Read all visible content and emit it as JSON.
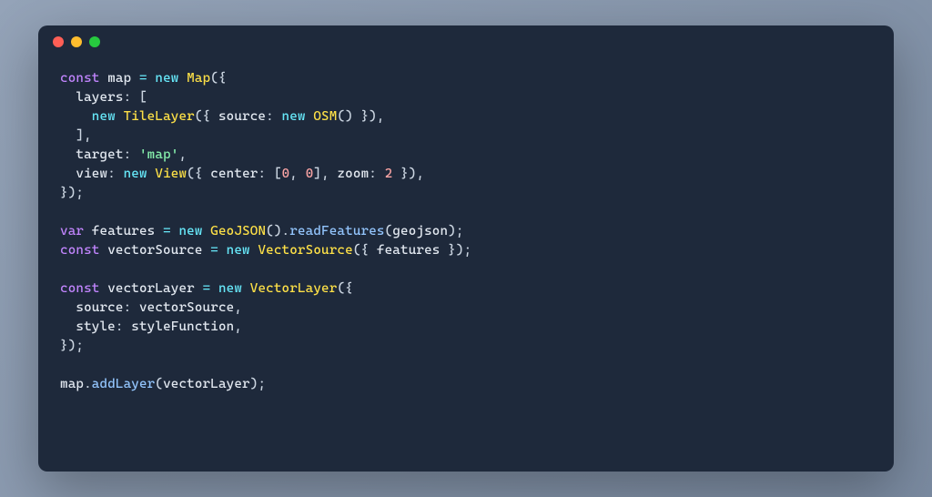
{
  "window": {
    "traffic_lights": [
      "close",
      "minimize",
      "maximize"
    ]
  },
  "code": {
    "tokens": [
      [
        {
          "t": "const",
          "c": "kw"
        },
        {
          "t": " ",
          "c": ""
        },
        {
          "t": "map",
          "c": "var"
        },
        {
          "t": " ",
          "c": ""
        },
        {
          "t": "=",
          "c": "op"
        },
        {
          "t": " ",
          "c": ""
        },
        {
          "t": "new",
          "c": "new"
        },
        {
          "t": " ",
          "c": ""
        },
        {
          "t": "Map",
          "c": "cls"
        },
        {
          "t": "({",
          "c": "punc"
        }
      ],
      [
        {
          "t": "  layers",
          "c": "prop"
        },
        {
          "t": ":",
          "c": "punc"
        },
        {
          "t": " [",
          "c": "punc"
        }
      ],
      [
        {
          "t": "    ",
          "c": ""
        },
        {
          "t": "new",
          "c": "new"
        },
        {
          "t": " ",
          "c": ""
        },
        {
          "t": "TileLayer",
          "c": "cls"
        },
        {
          "t": "({ ",
          "c": "punc"
        },
        {
          "t": "source",
          "c": "prop"
        },
        {
          "t": ":",
          "c": "punc"
        },
        {
          "t": " ",
          "c": ""
        },
        {
          "t": "new",
          "c": "new"
        },
        {
          "t": " ",
          "c": ""
        },
        {
          "t": "OSM",
          "c": "cls"
        },
        {
          "t": "() }),",
          "c": "punc"
        }
      ],
      [
        {
          "t": "  ],",
          "c": "punc"
        }
      ],
      [
        {
          "t": "  target",
          "c": "prop"
        },
        {
          "t": ":",
          "c": "punc"
        },
        {
          "t": " ",
          "c": ""
        },
        {
          "t": "'map'",
          "c": "str"
        },
        {
          "t": ",",
          "c": "punc"
        }
      ],
      [
        {
          "t": "  view",
          "c": "prop"
        },
        {
          "t": ":",
          "c": "punc"
        },
        {
          "t": " ",
          "c": ""
        },
        {
          "t": "new",
          "c": "new"
        },
        {
          "t": " ",
          "c": ""
        },
        {
          "t": "View",
          "c": "cls"
        },
        {
          "t": "({ ",
          "c": "punc"
        },
        {
          "t": "center",
          "c": "prop"
        },
        {
          "t": ":",
          "c": "punc"
        },
        {
          "t": " [",
          "c": "punc"
        },
        {
          "t": "0",
          "c": "num"
        },
        {
          "t": ", ",
          "c": "punc"
        },
        {
          "t": "0",
          "c": "num"
        },
        {
          "t": "], ",
          "c": "punc"
        },
        {
          "t": "zoom",
          "c": "prop"
        },
        {
          "t": ":",
          "c": "punc"
        },
        {
          "t": " ",
          "c": ""
        },
        {
          "t": "2",
          "c": "num"
        },
        {
          "t": " }),",
          "c": "punc"
        }
      ],
      [
        {
          "t": "});",
          "c": "punc"
        }
      ],
      [
        {
          "t": "",
          "c": ""
        }
      ],
      [
        {
          "t": "var",
          "c": "kw"
        },
        {
          "t": " ",
          "c": ""
        },
        {
          "t": "features",
          "c": "var"
        },
        {
          "t": " ",
          "c": ""
        },
        {
          "t": "=",
          "c": "op"
        },
        {
          "t": " ",
          "c": ""
        },
        {
          "t": "new",
          "c": "new"
        },
        {
          "t": " ",
          "c": ""
        },
        {
          "t": "GeoJSON",
          "c": "cls"
        },
        {
          "t": "().",
          "c": "punc"
        },
        {
          "t": "readFeatures",
          "c": "fn"
        },
        {
          "t": "(",
          "c": "punc"
        },
        {
          "t": "geojson",
          "c": "var"
        },
        {
          "t": ");",
          "c": "punc"
        }
      ],
      [
        {
          "t": "const",
          "c": "kw"
        },
        {
          "t": " ",
          "c": ""
        },
        {
          "t": "vectorSource",
          "c": "var"
        },
        {
          "t": " ",
          "c": ""
        },
        {
          "t": "=",
          "c": "op"
        },
        {
          "t": " ",
          "c": ""
        },
        {
          "t": "new",
          "c": "new"
        },
        {
          "t": " ",
          "c": ""
        },
        {
          "t": "VectorSource",
          "c": "cls"
        },
        {
          "t": "({ ",
          "c": "punc"
        },
        {
          "t": "features",
          "c": "var"
        },
        {
          "t": " });",
          "c": "punc"
        }
      ],
      [
        {
          "t": "",
          "c": ""
        }
      ],
      [
        {
          "t": "const",
          "c": "kw"
        },
        {
          "t": " ",
          "c": ""
        },
        {
          "t": "vectorLayer",
          "c": "var"
        },
        {
          "t": " ",
          "c": ""
        },
        {
          "t": "=",
          "c": "op"
        },
        {
          "t": " ",
          "c": ""
        },
        {
          "t": "new",
          "c": "new"
        },
        {
          "t": " ",
          "c": ""
        },
        {
          "t": "VectorLayer",
          "c": "cls"
        },
        {
          "t": "({",
          "c": "punc"
        }
      ],
      [
        {
          "t": "  source",
          "c": "prop"
        },
        {
          "t": ":",
          "c": "punc"
        },
        {
          "t": " ",
          "c": ""
        },
        {
          "t": "vectorSource",
          "c": "var"
        },
        {
          "t": ",",
          "c": "punc"
        }
      ],
      [
        {
          "t": "  style",
          "c": "prop"
        },
        {
          "t": ":",
          "c": "punc"
        },
        {
          "t": " ",
          "c": ""
        },
        {
          "t": "styleFunction",
          "c": "var"
        },
        {
          "t": ",",
          "c": "punc"
        }
      ],
      [
        {
          "t": "});",
          "c": "punc"
        }
      ],
      [
        {
          "t": "",
          "c": ""
        }
      ],
      [
        {
          "t": "map",
          "c": "var"
        },
        {
          "t": ".",
          "c": "punc"
        },
        {
          "t": "addLayer",
          "c": "fn"
        },
        {
          "t": "(",
          "c": "punc"
        },
        {
          "t": "vectorLayer",
          "c": "var"
        },
        {
          "t": ");",
          "c": "punc"
        }
      ]
    ]
  }
}
